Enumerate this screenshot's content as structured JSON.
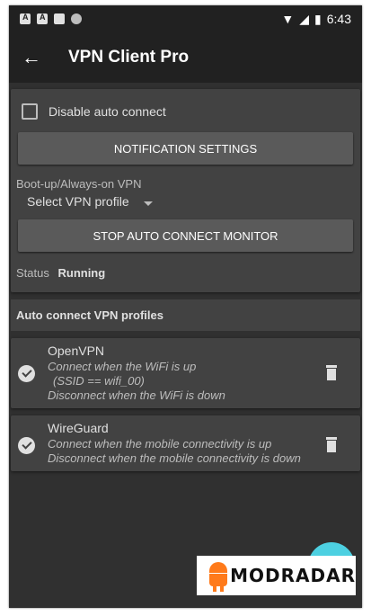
{
  "status_bar": {
    "time": "6:43"
  },
  "app_bar": {
    "back_icon": "arrow-left-icon",
    "title": "VPN Client Pro"
  },
  "settings": {
    "disable_auto_connect_label": "Disable auto connect",
    "notification_button": "NOTIFICATION SETTINGS",
    "boot_label": "Boot-up/Always-on VPN",
    "select_value": "Select VPN profile",
    "stop_monitor_button": "STOP AUTO CONNECT MONITOR",
    "status_label": "Status",
    "status_value": "Running"
  },
  "profiles": {
    "header": "Auto connect VPN profiles",
    "items": [
      {
        "name": "OpenVPN",
        "lines": [
          "Connect when the WiFi is up",
          "(SSID == wifi_00)",
          "Disconnect when the WiFi is down"
        ]
      },
      {
        "name": "WireGuard",
        "lines": [
          "Connect when the mobile connectivity is up",
          "Disconnect when the mobile connectivity is down"
        ]
      }
    ]
  },
  "fab": {
    "icon": "plus-icon",
    "label": "+"
  },
  "watermark": {
    "text": "MODRADAR"
  },
  "colors": {
    "accent": "#4dd0e1",
    "background": "#303030",
    "card": "#424242"
  }
}
